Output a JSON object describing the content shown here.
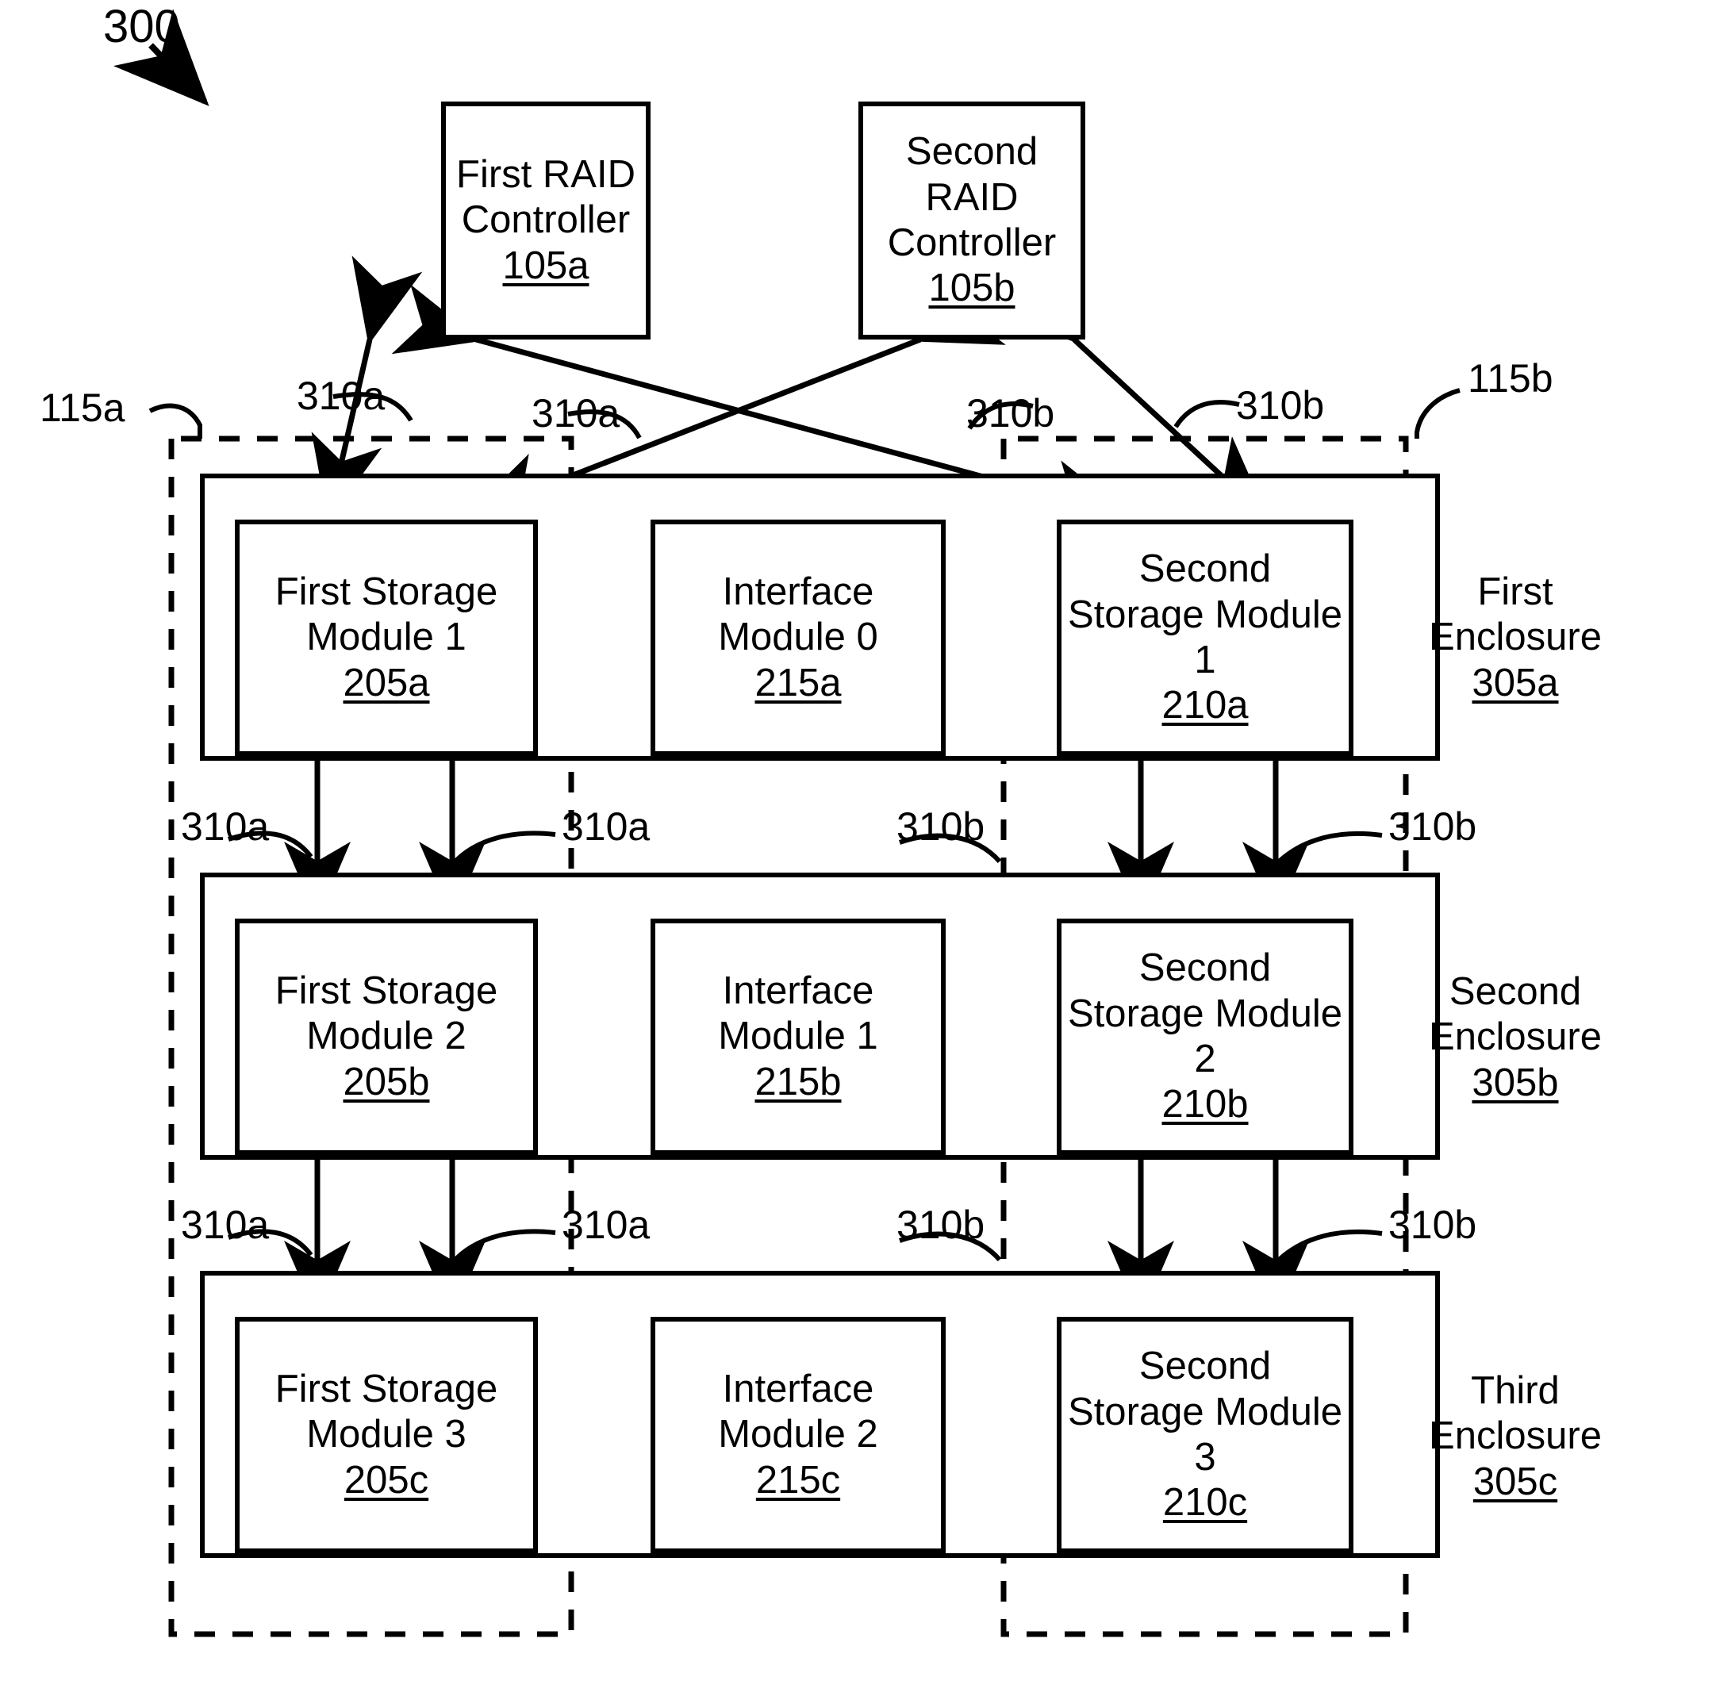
{
  "figure": {
    "number": "300"
  },
  "controllers": [
    {
      "line1": "First RAID",
      "line2": "Controller",
      "ref": "105a"
    },
    {
      "line1": "Second RAID",
      "line2": "Controller",
      "ref": "105b"
    }
  ],
  "domains": [
    {
      "ref": "115a"
    },
    {
      "ref": "115b"
    }
  ],
  "enclosures": [
    {
      "label_line1": "First",
      "label_line2": "Enclosure",
      "label_ref": "305a",
      "first_storage": {
        "line1": "First Storage",
        "line2": "Module 1",
        "ref": "205a"
      },
      "interface": {
        "line1": "Interface",
        "line2": "Module 0",
        "ref": "215a"
      },
      "second_storage": {
        "line1": "Second",
        "line2": "Storage Module",
        "line3": "1",
        "ref": "210a"
      }
    },
    {
      "label_line1": "Second",
      "label_line2": "Enclosure",
      "label_ref": "305b",
      "first_storage": {
        "line1": "First Storage",
        "line2": "Module 2",
        "ref": "205b"
      },
      "interface": {
        "line1": "Interface",
        "line2": "Module 1",
        "ref": "215b"
      },
      "second_storage": {
        "line1": "Second",
        "line2": "Storage Module",
        "line3": "2",
        "ref": "210b"
      }
    },
    {
      "label_line1": "Third",
      "label_line2": "Enclosure",
      "label_ref": "305c",
      "first_storage": {
        "line1": "First Storage",
        "line2": "Module 3",
        "ref": "205c"
      },
      "interface": {
        "line1": "Interface",
        "line2": "Module 2",
        "ref": "215c"
      },
      "second_storage": {
        "line1": "Second",
        "line2": "Storage Module",
        "line3": "3",
        "ref": "210c"
      }
    }
  ],
  "link_labels": {
    "a": "310a",
    "b": "310b",
    "top_row": [
      "310a",
      "310a",
      "310b",
      "310b"
    ],
    "mid_row_1": [
      "310a",
      "310a",
      "310b",
      "310b"
    ],
    "mid_row_2": [
      "310a",
      "310a",
      "310b",
      "310b"
    ]
  },
  "colors": {
    "stroke": "#000000",
    "background": "#ffffff"
  }
}
